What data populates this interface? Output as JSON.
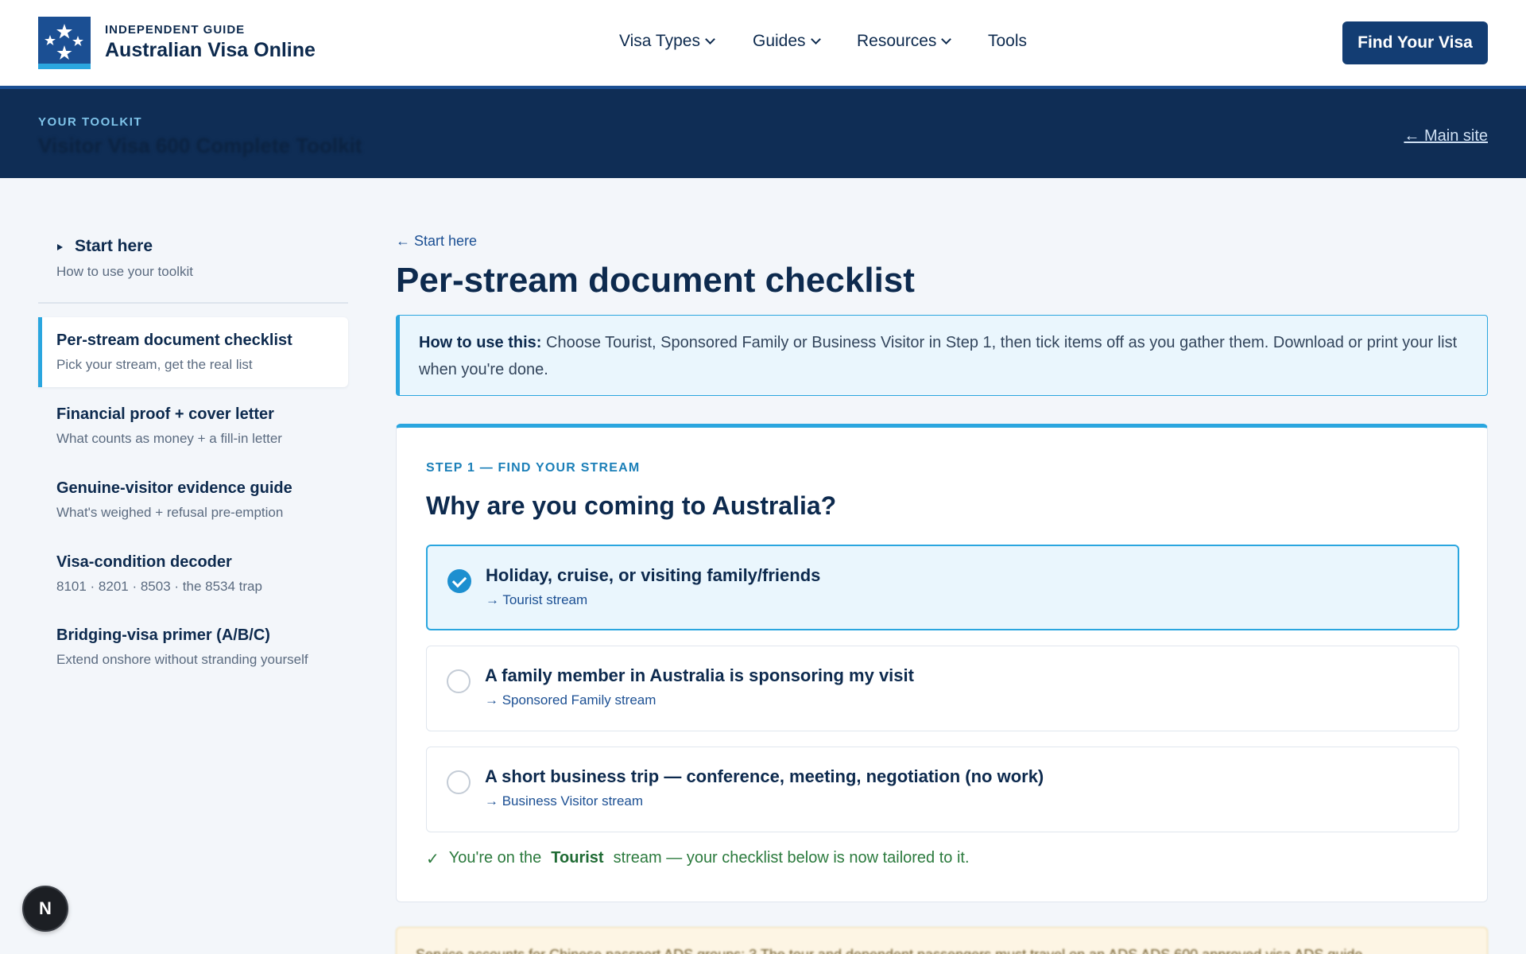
{
  "colors": {
    "navy": "#0d2a4e",
    "accent": "#2aa6df",
    "band": "#0f2d55",
    "cta": "#133d73",
    "success": "#2b7a3d"
  },
  "header": {
    "logo_icon": "southern-cross-stars-icon",
    "brand_small": "INDEPENDENT GUIDE",
    "brand_name": "Australian Visa Online",
    "nav": [
      {
        "label": "Visa Types",
        "has_dropdown": true
      },
      {
        "label": "Guides",
        "has_dropdown": true
      },
      {
        "label": "Resources",
        "has_dropdown": true
      },
      {
        "label": "Tools",
        "has_dropdown": false
      }
    ],
    "cta_label": "Find Your Visa"
  },
  "toolkit_band": {
    "kicker": "YOUR TOOLKIT",
    "title": "Visitor Visa 600 Complete Toolkit",
    "main_site_link": "← Main site"
  },
  "sidebar": {
    "start": {
      "title": "Start here",
      "subtitle": "How to use your toolkit"
    },
    "items": [
      {
        "title": "Per-stream document checklist",
        "subtitle": "Pick your stream, get the real list",
        "active": true
      },
      {
        "title": "Financial proof + cover letter",
        "subtitle": "What counts as money + a fill-in letter",
        "active": false
      },
      {
        "title": "Genuine-visitor evidence guide",
        "subtitle": "What's weighed + refusal pre-emption",
        "active": false
      },
      {
        "title": "Visa-condition decoder",
        "subtitle": "8101 · 8201 · 8503 · the 8534 trap",
        "active": false
      },
      {
        "title": "Bridging-visa primer (A/B/C)",
        "subtitle": "Extend onshore without stranding yourself",
        "active": false
      }
    ]
  },
  "main": {
    "back_link": "← Start here",
    "title": "Per-stream document checklist",
    "howto": {
      "label": "How to use this:",
      "text": "Choose Tourist, Sponsored Family or Business Visitor in Step 1, then tick items off as you gather them. Download or print your list when you're done."
    },
    "step": {
      "kicker": "STEP 1 — FIND YOUR STREAM",
      "question": "Why are you coming to Australia?",
      "options": [
        {
          "title": "Holiday, cruise, or visiting family/friends",
          "stream": "→ Tourist stream",
          "selected": true
        },
        {
          "title": "A family member in Australia is sponsoring my visit",
          "stream": "→ Sponsored Family stream",
          "selected": false
        },
        {
          "title": "A short business trip — conference, meeting, negotiation (no work)",
          "stream": "→ Business Visitor stream",
          "selected": false
        }
      ],
      "confirm": {
        "check": "✓",
        "before": "You're on the",
        "stream": "Tourist",
        "after": "stream — your checklist below is now tailored to it."
      }
    },
    "notice_text": "Service accounts for Chinese passport ADS groups: 3 The tour and dependent passengers must travel on an ADS ADS 600 approved visa ADS guide"
  },
  "fab_label": "N"
}
